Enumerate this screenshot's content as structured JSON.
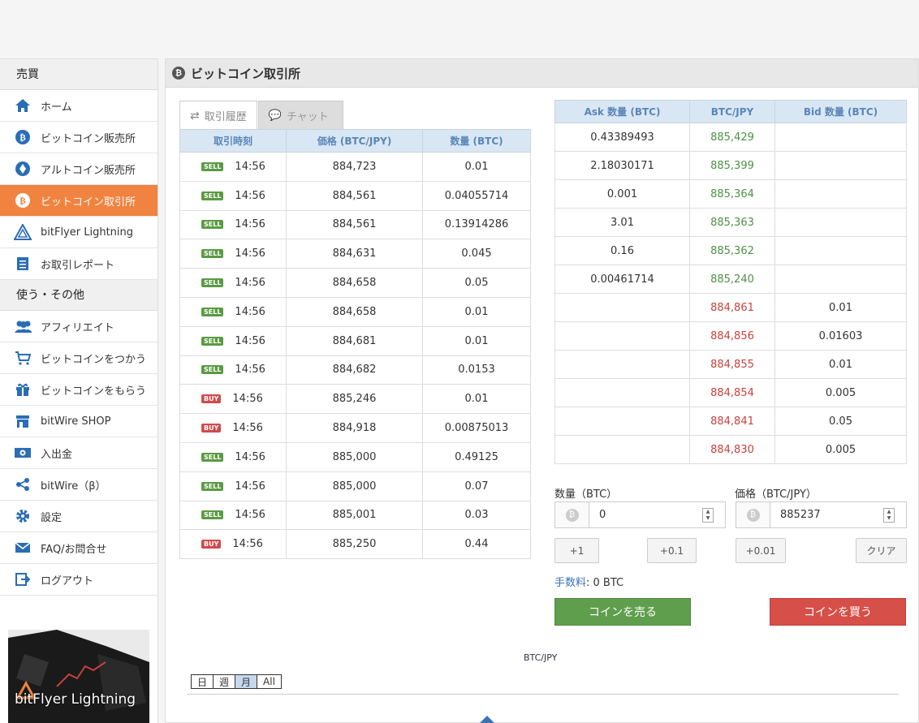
{
  "sidebar": {
    "section1": "売買",
    "items1": [
      {
        "label": "ホーム",
        "icon": "home-icon"
      },
      {
        "label": "ビットコイン販売所",
        "icon": "bitcoin-icon"
      },
      {
        "label": "アルトコイン販売所",
        "icon": "altcoin-icon"
      },
      {
        "label": "ビットコイン取引所",
        "icon": "bitcoin-icon",
        "active": true
      },
      {
        "label": "bitFlyer Lightning",
        "icon": "lightning-icon"
      },
      {
        "label": "お取引レポート",
        "icon": "report-icon"
      }
    ],
    "section2": "使う・その他",
    "items2": [
      {
        "label": "アフィリエイト",
        "icon": "users-icon"
      },
      {
        "label": "ビットコインをつかう",
        "icon": "cart-icon"
      },
      {
        "label": "ビットコインをもらう",
        "icon": "gift-icon"
      },
      {
        "label": "bitWire SHOP",
        "icon": "shop-icon"
      },
      {
        "label": "入出金",
        "icon": "money-icon"
      },
      {
        "label": "bitWire（β）",
        "icon": "share-icon"
      },
      {
        "label": "設定",
        "icon": "gear-icon"
      },
      {
        "label": "FAQ/お問合せ",
        "icon": "mail-icon"
      },
      {
        "label": "ログアウト",
        "icon": "logout-icon"
      }
    ],
    "banner": "bitFlyer Lightning"
  },
  "header": {
    "title": "ビットコイン取引所"
  },
  "tabs": {
    "history": "取引履歴",
    "chat": "チャット"
  },
  "history": {
    "headers": [
      "取引時刻",
      "価格 (BTC/JPY)",
      "数量 (BTC)"
    ],
    "rows": [
      {
        "side": "SELL",
        "time": "14:56",
        "price": "884,723",
        "qty": "0.01"
      },
      {
        "side": "SELL",
        "time": "14:56",
        "price": "884,561",
        "qty": "0.04055714"
      },
      {
        "side": "SELL",
        "time": "14:56",
        "price": "884,561",
        "qty": "0.13914286"
      },
      {
        "side": "SELL",
        "time": "14:56",
        "price": "884,631",
        "qty": "0.045"
      },
      {
        "side": "SELL",
        "time": "14:56",
        "price": "884,658",
        "qty": "0.05"
      },
      {
        "side": "SELL",
        "time": "14:56",
        "price": "884,658",
        "qty": "0.01"
      },
      {
        "side": "SELL",
        "time": "14:56",
        "price": "884,681",
        "qty": "0.01"
      },
      {
        "side": "SELL",
        "time": "14:56",
        "price": "884,682",
        "qty": "0.0153"
      },
      {
        "side": "BUY",
        "time": "14:56",
        "price": "885,246",
        "qty": "0.01"
      },
      {
        "side": "BUY",
        "time": "14:56",
        "price": "884,918",
        "qty": "0.00875013"
      },
      {
        "side": "SELL",
        "time": "14:56",
        "price": "885,000",
        "qty": "0.49125"
      },
      {
        "side": "SELL",
        "time": "14:56",
        "price": "885,000",
        "qty": "0.07"
      },
      {
        "side": "SELL",
        "time": "14:56",
        "price": "885,001",
        "qty": "0.03"
      },
      {
        "side": "BUY",
        "time": "14:56",
        "price": "885,250",
        "qty": "0.44"
      }
    ]
  },
  "book": {
    "headers": [
      "Ask 数量 (BTC)",
      "BTC/JPY",
      "Bid 数量 (BTC)"
    ],
    "rows": [
      {
        "ask": "0.43389493",
        "price": "885,429",
        "bid": "",
        "color": "green"
      },
      {
        "ask": "2.18030171",
        "price": "885,399",
        "bid": "",
        "color": "green"
      },
      {
        "ask": "0.001",
        "price": "885,364",
        "bid": "",
        "color": "green"
      },
      {
        "ask": "3.01",
        "price": "885,363",
        "bid": "",
        "color": "green"
      },
      {
        "ask": "0.16",
        "price": "885,362",
        "bid": "",
        "color": "green"
      },
      {
        "ask": "0.00461714",
        "price": "885,240",
        "bid": "",
        "color": "green"
      },
      {
        "ask": "",
        "price": "884,861",
        "bid": "0.01",
        "color": "red"
      },
      {
        "ask": "",
        "price": "884,856",
        "bid": "0.01603",
        "color": "red"
      },
      {
        "ask": "",
        "price": "884,855",
        "bid": "0.01",
        "color": "red"
      },
      {
        "ask": "",
        "price": "884,854",
        "bid": "0.005",
        "color": "red"
      },
      {
        "ask": "",
        "price": "884,841",
        "bid": "0.05",
        "color": "red"
      },
      {
        "ask": "",
        "price": "884,830",
        "bid": "0.005",
        "color": "red"
      }
    ]
  },
  "form": {
    "qty_label": "数量（BTC）",
    "qty_value": "0",
    "price_label": "価格（BTC/JPY）",
    "price_value": "885237",
    "btn_plus1": "+1",
    "btn_plus01": "+0.1",
    "btn_plus001": "+0.01",
    "btn_clear": "クリア",
    "fee_label": "手数料",
    "fee_value": ": 0 BTC",
    "sell": "コインを売る",
    "buy": "コインを買う"
  },
  "chart": {
    "title": "BTC/JPY",
    "ranges": [
      "日",
      "週",
      "月",
      "All"
    ],
    "selected": "月"
  },
  "colors": {
    "accent": "#f0833f",
    "green": "#4e9044",
    "red": "#c9413b",
    "sell_btn": "#5f9e4d",
    "buy_btn": "#d64f49",
    "header_blue": "#5a86b8"
  }
}
